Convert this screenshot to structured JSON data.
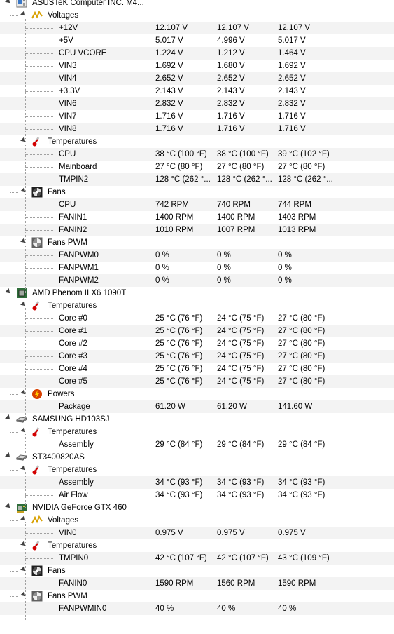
{
  "tree": [
    {
      "level": 0,
      "icon": "motherboard-icon",
      "label": "ASUSTeK Computer INC. M4..."
    },
    {
      "level": 1,
      "icon": "voltage-icon",
      "label": "Voltages"
    },
    {
      "level": 2,
      "label": "+12V",
      "values": [
        "12.107 V",
        "12.107 V",
        "12.107 V"
      ]
    },
    {
      "level": 2,
      "label": "+5V",
      "values": [
        "5.017 V",
        "4.996 V",
        "5.017 V"
      ]
    },
    {
      "level": 2,
      "label": "CPU VCORE",
      "values": [
        "1.224 V",
        "1.212 V",
        "1.464 V"
      ]
    },
    {
      "level": 2,
      "label": "VIN3",
      "values": [
        "1.692 V",
        "1.680 V",
        "1.692 V"
      ]
    },
    {
      "level": 2,
      "label": "VIN4",
      "values": [
        "2.652 V",
        "2.652 V",
        "2.652 V"
      ]
    },
    {
      "level": 2,
      "label": "+3.3V",
      "values": [
        "2.143 V",
        "2.143 V",
        "2.143 V"
      ]
    },
    {
      "level": 2,
      "label": "VIN6",
      "values": [
        "2.832 V",
        "2.832 V",
        "2.832 V"
      ]
    },
    {
      "level": 2,
      "label": "VIN7",
      "values": [
        "1.716 V",
        "1.716 V",
        "1.716 V"
      ]
    },
    {
      "level": 2,
      "label": "VIN8",
      "values": [
        "1.716 V",
        "1.716 V",
        "1.716 V"
      ]
    },
    {
      "level": 1,
      "icon": "thermometer-icon",
      "label": "Temperatures"
    },
    {
      "level": 2,
      "label": "CPU",
      "values": [
        "38 °C  (100 °F)",
        "38 °C  (100 °F)",
        "39 °C  (102 °F)"
      ]
    },
    {
      "level": 2,
      "label": "Mainboard",
      "values": [
        "27 °C  (80 °F)",
        "27 °C  (80 °F)",
        "27 °C  (80 °F)"
      ]
    },
    {
      "level": 2,
      "label": "TMPIN2",
      "values": [
        "128 °C  (262 °...",
        "128 °C  (262 °...",
        "128 °C  (262 °..."
      ]
    },
    {
      "level": 1,
      "icon": "fan-icon",
      "label": "Fans"
    },
    {
      "level": 2,
      "label": "CPU",
      "values": [
        "742 RPM",
        "740 RPM",
        "744 RPM"
      ]
    },
    {
      "level": 2,
      "label": "FANIN1",
      "values": [
        "1400 RPM",
        "1400 RPM",
        "1403 RPM"
      ]
    },
    {
      "level": 2,
      "label": "FANIN2",
      "values": [
        "1010 RPM",
        "1007 RPM",
        "1013 RPM"
      ]
    },
    {
      "level": 1,
      "icon": "fan-pwm-icon",
      "label": "Fans PWM"
    },
    {
      "level": 2,
      "label": "FANPWM0",
      "values": [
        "0 %",
        "0 %",
        "0 %"
      ]
    },
    {
      "level": 2,
      "label": "FANPWM1",
      "values": [
        "0 %",
        "0 %",
        "0 %"
      ]
    },
    {
      "level": 2,
      "label": "FANPWM2",
      "values": [
        "0 %",
        "0 %",
        "0 %"
      ]
    },
    {
      "level": 0,
      "icon": "cpu-chip-icon",
      "label": "AMD Phenom II X6 1090T"
    },
    {
      "level": 1,
      "icon": "thermometer-icon",
      "label": "Temperatures"
    },
    {
      "level": 2,
      "label": "Core #0",
      "values": [
        "25 °C  (76 °F)",
        "24 °C  (75 °F)",
        "27 °C  (80 °F)"
      ]
    },
    {
      "level": 2,
      "label": "Core #1",
      "values": [
        "25 °C  (76 °F)",
        "24 °C  (75 °F)",
        "27 °C  (80 °F)"
      ]
    },
    {
      "level": 2,
      "label": "Core #2",
      "values": [
        "25 °C  (76 °F)",
        "24 °C  (75 °F)",
        "27 °C  (80 °F)"
      ]
    },
    {
      "level": 2,
      "label": "Core #3",
      "values": [
        "25 °C  (76 °F)",
        "24 °C  (75 °F)",
        "27 °C  (80 °F)"
      ]
    },
    {
      "level": 2,
      "label": "Core #4",
      "values": [
        "25 °C  (76 °F)",
        "24 °C  (75 °F)",
        "27 °C  (80 °F)"
      ]
    },
    {
      "level": 2,
      "label": "Core #5",
      "values": [
        "25 °C  (76 °F)",
        "24 °C  (75 °F)",
        "27 °C  (80 °F)"
      ]
    },
    {
      "level": 1,
      "icon": "power-icon",
      "label": "Powers"
    },
    {
      "level": 2,
      "label": "Package",
      "values": [
        "61.20 W",
        "61.20 W",
        "141.60 W"
      ]
    },
    {
      "level": 0,
      "icon": "hard-drive-icon",
      "label": "SAMSUNG HD103SJ"
    },
    {
      "level": 1,
      "icon": "thermometer-icon",
      "label": "Temperatures"
    },
    {
      "level": 2,
      "label": "Assembly",
      "values": [
        "29 °C  (84 °F)",
        "29 °C  (84 °F)",
        "29 °C  (84 °F)"
      ]
    },
    {
      "level": 0,
      "icon": "hard-drive-icon",
      "label": "ST3400820AS"
    },
    {
      "level": 1,
      "icon": "thermometer-icon",
      "label": "Temperatures"
    },
    {
      "level": 2,
      "label": "Assembly",
      "values": [
        "34 °C  (93 °F)",
        "34 °C  (93 °F)",
        "34 °C  (93 °F)"
      ]
    },
    {
      "level": 2,
      "label": "Air Flow",
      "values": [
        "34 °C  (93 °F)",
        "34 °C  (93 °F)",
        "34 °C  (93 °F)"
      ]
    },
    {
      "level": 0,
      "icon": "gpu-card-icon",
      "label": "NVIDIA GeForce GTX 460"
    },
    {
      "level": 1,
      "icon": "voltage-icon",
      "label": "Voltages"
    },
    {
      "level": 2,
      "label": "VIN0",
      "values": [
        "0.975 V",
        "0.975 V",
        "0.975 V"
      ]
    },
    {
      "level": 1,
      "icon": "thermometer-icon",
      "label": "Temperatures"
    },
    {
      "level": 2,
      "label": "TMPIN0",
      "values": [
        "42 °C  (107 °F)",
        "42 °C  (107 °F)",
        "43 °C  (109 °F)"
      ]
    },
    {
      "level": 1,
      "icon": "fan-icon",
      "label": "Fans"
    },
    {
      "level": 2,
      "label": "FANIN0",
      "values": [
        "1590 RPM",
        "1560 RPM",
        "1590 RPM"
      ]
    },
    {
      "level": 1,
      "icon": "fan-pwm-icon",
      "label": "Fans PWM"
    },
    {
      "level": 2,
      "label": "FANPWMIN0",
      "values": [
        "40 %",
        "40 %",
        "40 %"
      ]
    }
  ]
}
